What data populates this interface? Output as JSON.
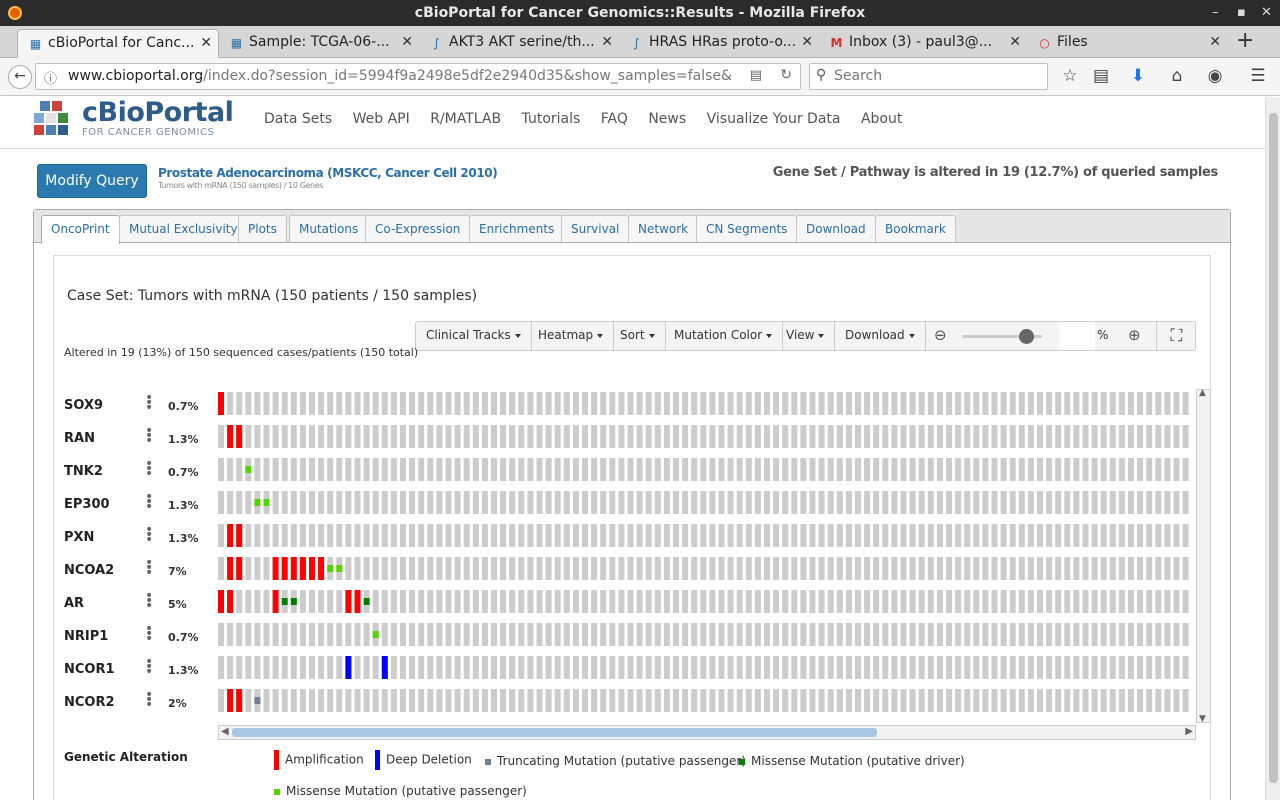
{
  "window": {
    "title": "cBioPortal for Cancer Genomics::Results - Mozilla Firefox"
  },
  "tabs": [
    {
      "label": "cBioPortal for Canc...",
      "icon": "cbio-icon",
      "active": true
    },
    {
      "label": "Sample: TCGA-06-...",
      "icon": "cbio-icon"
    },
    {
      "label": "AKT3 AKT serine/th...",
      "icon": "dna-icon"
    },
    {
      "label": "HRAS HRas proto-o...",
      "icon": "dna-icon"
    },
    {
      "label": "Inbox (3) - paul3@...",
      "icon": "gmail-icon"
    },
    {
      "label": "Files",
      "icon": "files-icon"
    }
  ],
  "nav": {
    "url_host": "www.cbioportal.org",
    "url_path": "/index.do?session_id=5994f9a2498e5df2e2940d35&show_samples=false&",
    "search_placeholder": "Search"
  },
  "site": {
    "logo_title": "cBioPortal",
    "logo_subtitle": "FOR CANCER GENOMICS",
    "menu": [
      "Data Sets",
      "Web API",
      "R/MATLAB",
      "Tutorials",
      "FAQ",
      "News",
      "Visualize Your Data",
      "About"
    ]
  },
  "query": {
    "modify_label": "Modify Query",
    "study": "Prostate Adenocarcinoma (MSKCC, Cancer Cell 2010)",
    "study_sub": "Tumors with mRNA (150 samples) / 10 Genes",
    "altered_summary": "Gene Set / Pathway is altered in 19 (12.7%) of queried samples"
  },
  "result_tabs": [
    "OncoPrint",
    "Mutual Exclusivity",
    "Plots",
    "Mutations",
    "Co-Expression",
    "Enrichments",
    "Survival",
    "Network",
    "CN Segments",
    "Download",
    "Bookmark"
  ],
  "oncoprint": {
    "case_set": "Case Set: Tumors with mRNA (150 patients / 150 samples)",
    "toolbar": [
      "Clinical Tracks",
      "Heatmap",
      "Sort",
      "Mutation Color",
      "View",
      "Download"
    ],
    "zoom_unit": "%",
    "altered_text": "Altered in 19 (13%) of 150 sequenced cases/patients (150 total)",
    "zoom_level": 0.8,
    "colors": {
      "amp": "#ff0000",
      "homdel": "#0000ff",
      "trunc_passenger": "#708090",
      "missense_driver": "#008000",
      "missense_passenger": "#53d400",
      "no_alt": "#cccccc"
    },
    "genes": [
      {
        "name": "SOX9",
        "pct": "0.7%",
        "alts": [
          [
            0,
            "amp"
          ]
        ]
      },
      {
        "name": "RAN",
        "pct": "1.3%",
        "alts": [
          [
            1,
            "amp"
          ],
          [
            2,
            "amp"
          ]
        ]
      },
      {
        "name": "TNK2",
        "pct": "0.7%",
        "alts": [
          [
            3,
            "missense_passenger"
          ]
        ]
      },
      {
        "name": "EP300",
        "pct": "1.3%",
        "alts": [
          [
            4,
            "missense_passenger"
          ],
          [
            5,
            "missense_passenger"
          ]
        ]
      },
      {
        "name": "PXN",
        "pct": "1.3%",
        "alts": [
          [
            1,
            "amp"
          ],
          [
            2,
            "amp"
          ]
        ]
      },
      {
        "name": "NCOA2",
        "pct": "7%",
        "alts": [
          [
            1,
            "amp"
          ],
          [
            2,
            "amp"
          ],
          [
            6,
            "amp"
          ],
          [
            7,
            "amp"
          ],
          [
            8,
            "amp"
          ],
          [
            9,
            "amp"
          ],
          [
            10,
            "amp"
          ],
          [
            11,
            "amp"
          ],
          [
            12,
            "missense_passenger"
          ],
          [
            13,
            "missense_passenger"
          ]
        ]
      },
      {
        "name": "AR",
        "pct": "5%",
        "alts": [
          [
            0,
            "amp"
          ],
          [
            1,
            "amp"
          ],
          [
            6,
            "amp"
          ],
          [
            7,
            "missense_driver"
          ],
          [
            8,
            "missense_driver"
          ],
          [
            14,
            "amp"
          ],
          [
            15,
            "amp"
          ],
          [
            16,
            "missense_driver"
          ]
        ]
      },
      {
        "name": "NRIP1",
        "pct": "0.7%",
        "alts": [
          [
            17,
            "missense_passenger"
          ]
        ]
      },
      {
        "name": "NCOR1",
        "pct": "1.3%",
        "alts": [
          [
            14,
            "homdel"
          ],
          [
            18,
            "homdel"
          ]
        ]
      },
      {
        "name": "NCOR2",
        "pct": "2%",
        "alts": [
          [
            1,
            "amp"
          ],
          [
            2,
            "amp"
          ],
          [
            4,
            "trunc_passenger"
          ]
        ]
      }
    ]
  },
  "legend": {
    "title": "Genetic Alteration",
    "items": [
      {
        "label": "Amplification",
        "kind": "amp"
      },
      {
        "label": "Deep Deletion",
        "kind": "homdel"
      },
      {
        "label": "Truncating Mutation (putative passenger)",
        "kind": "trunc_passenger"
      },
      {
        "label": "Missense Mutation (putative driver)",
        "kind": "missense_driver"
      },
      {
        "label": "Missense Mutation (putative passenger)",
        "kind": "missense_passenger"
      }
    ]
  }
}
